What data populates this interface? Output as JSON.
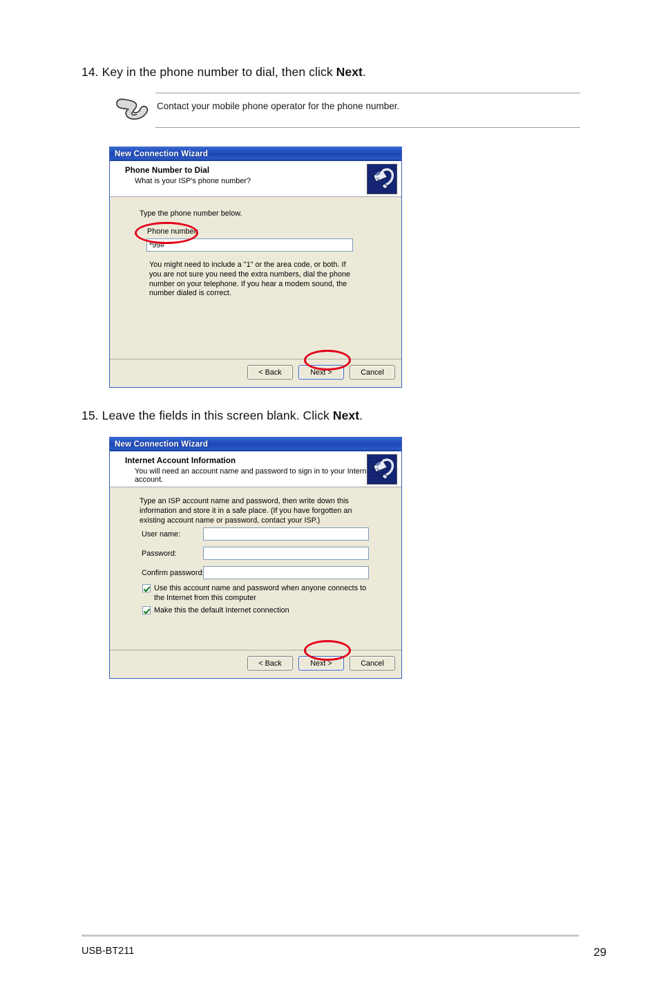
{
  "page": {
    "footer_left": "USB-BT211",
    "footer_page_number": "29"
  },
  "steps": [
    {
      "number": "14.",
      "text_before": "Key in the phone number to dial, then click ",
      "bold": "Next",
      "text_after": "."
    },
    {
      "number": "15.",
      "text_before": "Leave the fields in this screen blank. Click ",
      "bold": "Next",
      "text_after": "."
    }
  ],
  "note": {
    "icon": "pointing-hand-note-icon",
    "text": "Contact your mobile phone operator for the phone number."
  },
  "dialog1": {
    "title": "New Connection Wizard",
    "header_title": "Phone Number to Dial",
    "header_sub": "What is your ISP's phone number?",
    "header_icon": "modem-phone-icon",
    "intro": "Type the phone number below.",
    "field_label": "Phone number:",
    "field_value": "*99#",
    "hint": "You might need to include a \"1\" or the area code, or both. If you are not sure you need the extra numbers, dial the phone number on your telephone. If you hear a modem sound, the number dialed is correct.",
    "buttons": {
      "back": "< Back",
      "next": "Next >",
      "cancel": "Cancel"
    },
    "highlights": [
      "phone-number-field",
      "next-button"
    ]
  },
  "dialog2": {
    "title": "New Connection Wizard",
    "header_title": "Internet Account Information",
    "header_sub": "You will need an account name and password to sign in to your Internet account.",
    "header_icon": "modem-phone-icon",
    "intro": "Type an ISP account name and password, then write down this information and store it in a safe place. (If you have forgotten an existing account name or password, contact your ISP.)",
    "fields": [
      {
        "label": "User name:",
        "value": ""
      },
      {
        "label": "Password:",
        "value": ""
      },
      {
        "label": "Confirm password:",
        "value": ""
      }
    ],
    "checkboxes": [
      {
        "label": "Use this account name and password when anyone connects to the Internet from this computer",
        "checked": true
      },
      {
        "label": "Make this the default Internet connection",
        "checked": true
      }
    ],
    "buttons": {
      "back": "< Back",
      "next": "Next >",
      "cancel": "Cancel"
    },
    "highlights": [
      "next-button"
    ]
  },
  "colors": {
    "titlebar_blue": "#1e46b4",
    "dialog_face": "#ece9d8",
    "highlight_red": "#e2001a",
    "input_border": "#7f9db9",
    "check_green": "#0b7a16"
  }
}
